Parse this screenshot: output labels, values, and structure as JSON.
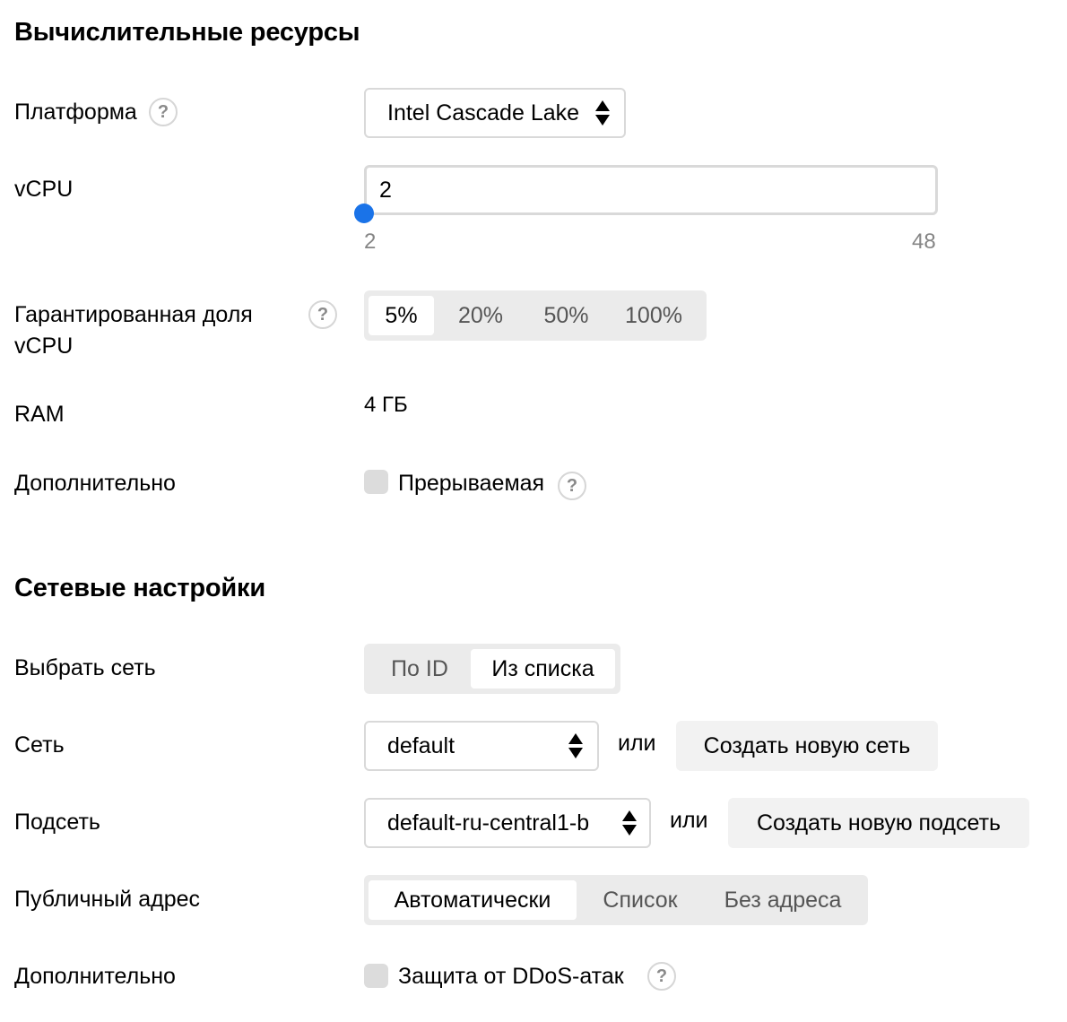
{
  "compute": {
    "title": "Вычислительные ресурсы",
    "platform": {
      "label": "Платформа",
      "help": "?",
      "value": "Intel Cascade Lake"
    },
    "vcpu": {
      "label": "vCPU",
      "value": "2",
      "min": "2",
      "max": "48",
      "level": 0
    },
    "guaranteed": {
      "label_line1": "Гарантированная доля",
      "label_line2": "vCPU",
      "help": "?",
      "options": [
        "5%",
        "20%",
        "50%",
        "100%"
      ],
      "selected": "5%"
    },
    "ram": {
      "label": "RAM",
      "value": "4 ГБ"
    },
    "extra": {
      "label": "Дополнительно",
      "checkbox_label": "Прерываемая",
      "help": "?",
      "checked": false
    }
  },
  "network": {
    "title": "Сетевые настройки",
    "choose": {
      "label": "Выбрать сеть",
      "options": [
        "По ID",
        "Из списка"
      ],
      "selected": "Из списка"
    },
    "net": {
      "label": "Сеть",
      "value": "default",
      "or": "или",
      "create": "Создать новую сеть"
    },
    "subnet": {
      "label": "Подсеть",
      "value": "default-ru-central1-b",
      "or": "или",
      "create": "Создать новую подсеть"
    },
    "public": {
      "label": "Публичный адрес",
      "options": [
        "Автоматически",
        "Список",
        "Без адреса"
      ],
      "selected": "Автоматически"
    },
    "extra": {
      "label": "Дополнительно",
      "checkbox_label": "Защита от DDoS-атак",
      "help": "?",
      "checked": false
    }
  },
  "colors": {
    "accent": "#1a73e8",
    "tabs_bg": "#ebebeb",
    "button_bg": "#f2f2f2"
  }
}
